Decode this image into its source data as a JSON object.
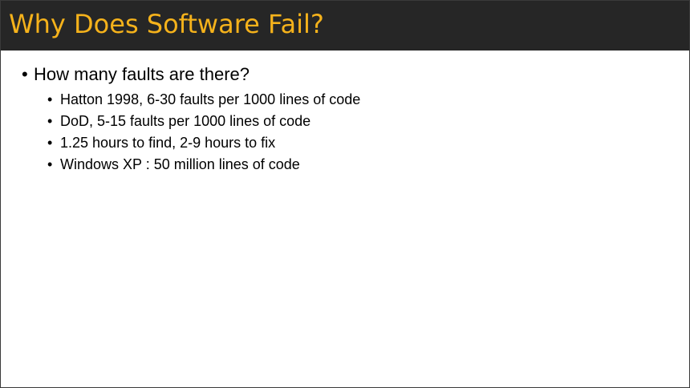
{
  "slide": {
    "title": "Why Does Software Fail?",
    "bullet_glyph": "•",
    "main_bullet": "How many faults are there?",
    "sub_bullets": [
      "Hatton 1998, 6-30 faults per 1000 lines of code",
      "DoD, 5-15 faults per 1000 lines of code",
      "1.25 hours to find, 2-9 hours to fix",
      "Windows XP : 50 million lines of code"
    ]
  },
  "colors": {
    "title_bar_bg": "#262626",
    "title_text": "#f5b21b",
    "body_bg": "#ffffff",
    "body_text": "#000000"
  }
}
